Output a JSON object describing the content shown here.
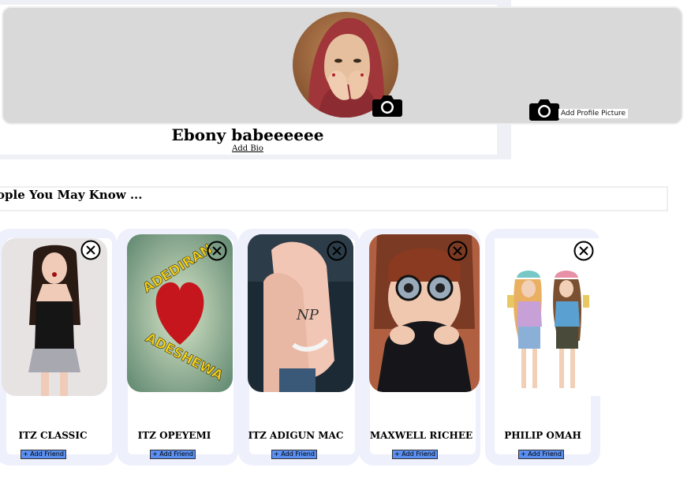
{
  "profile": {
    "name": "Ebony babeeeeee",
    "add_bio": "Add Bio",
    "add_profile_picture": "Add Profile Picture"
  },
  "pymk": {
    "heading": "ople You May Know ..."
  },
  "suggestions": [
    {
      "name": "ITZ CLASSIC",
      "add_label": "+ Add Friend"
    },
    {
      "name": "ITZ OPEYEMI",
      "add_label": "+ Add Friend"
    },
    {
      "name": "ITZ ADIGUN MAC",
      "add_label": "+ Add Friend"
    },
    {
      "name": "MAXWELL RICHEE",
      "add_label": "+ Add Friend"
    },
    {
      "name": "PHILIP OMAH",
      "add_label": "+ Add Friend"
    }
  ],
  "photo_text": {
    "card2_top": "ADEDIRAN",
    "card2_bottom": "ADESHEWA",
    "card3_hand": "NP"
  },
  "icons": {
    "camera": "camera-icon",
    "close": "close-icon"
  },
  "colors": {
    "cover": "#d9d9d9",
    "button": "#5b8ff0",
    "card_bg": "#eef0fb"
  }
}
